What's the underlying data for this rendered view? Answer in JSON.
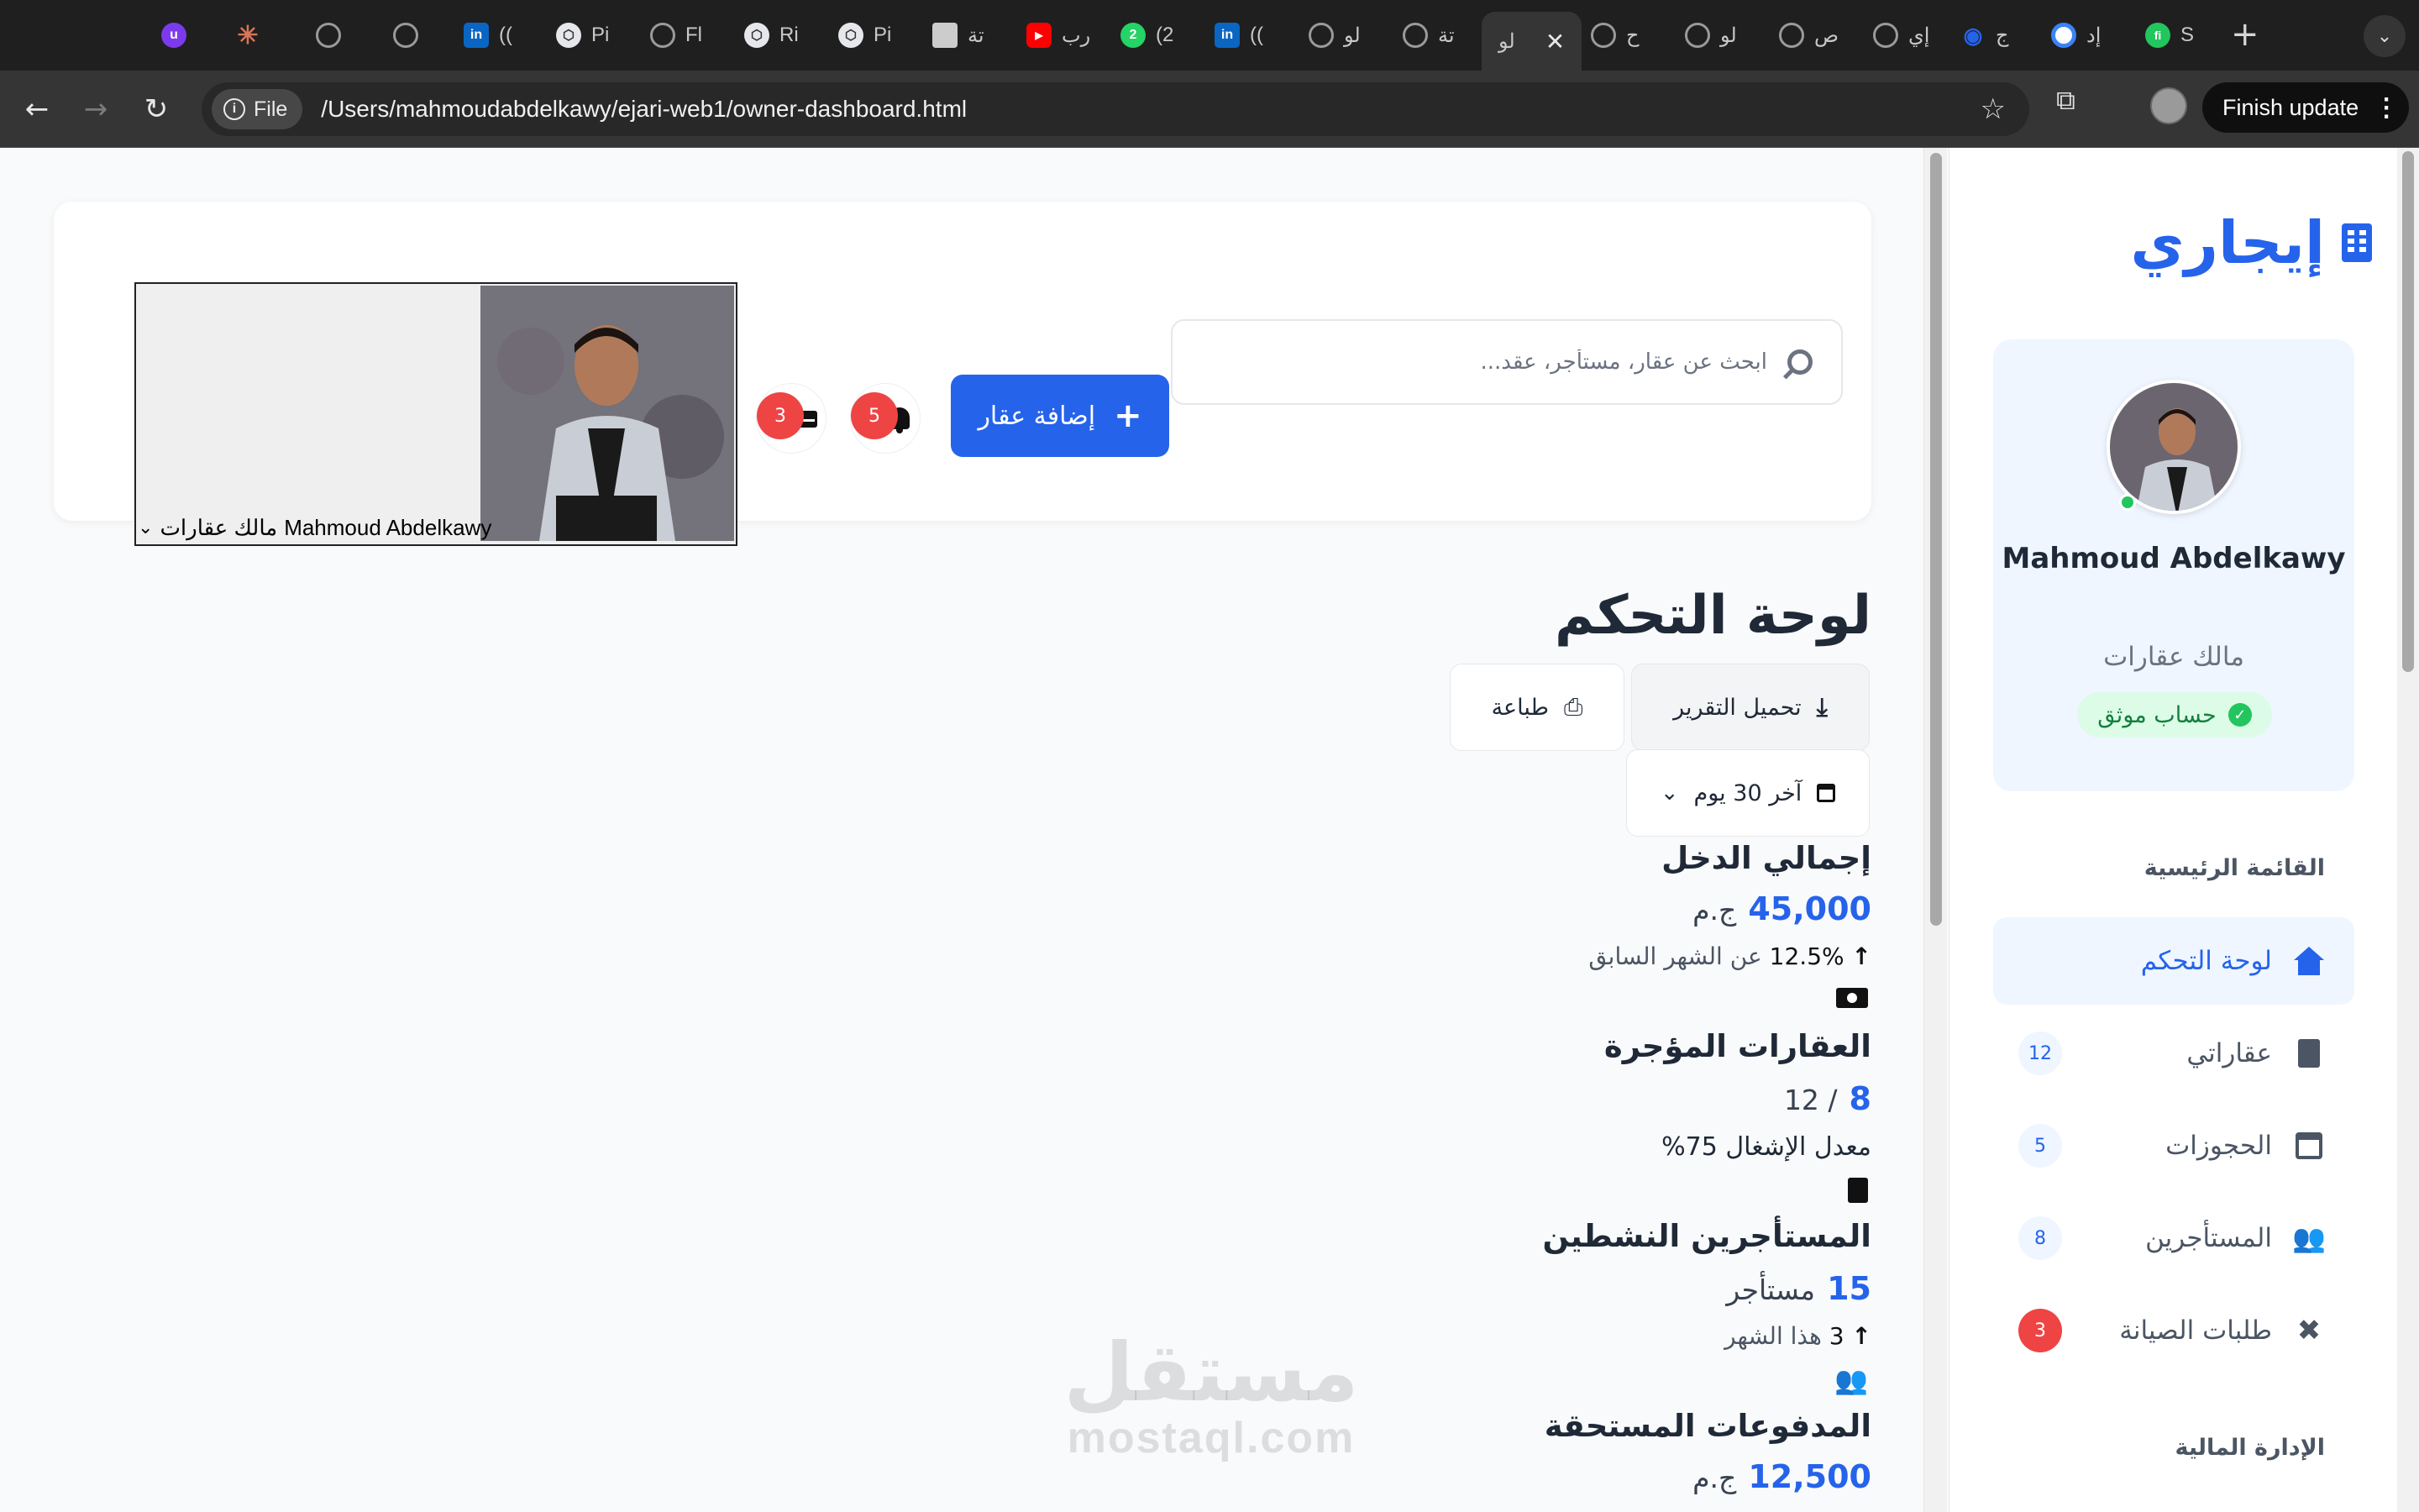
{
  "browser": {
    "tabs": [
      {
        "title": "",
        "favicon": "u-icon",
        "color": "#7c3aed"
      },
      {
        "title": "",
        "favicon": "sunburst-icon",
        "color": "#d97757"
      },
      {
        "title": "",
        "favicon": "globe-icon",
        "color": "#8a8a8a"
      },
      {
        "title": "",
        "favicon": "globe-icon",
        "color": "#8a8a8a"
      },
      {
        "title": "((",
        "favicon": "linkedin-icon",
        "color": "#0a66c2"
      },
      {
        "title": "Pi",
        "favicon": "hexagon-icon",
        "color": "#e5e7eb"
      },
      {
        "title": "Fl",
        "favicon": "globe-icon",
        "color": "#8a8a8a"
      },
      {
        "title": "Ri",
        "favicon": "hexagon-icon",
        "color": "#e5e7eb"
      },
      {
        "title": "Pi",
        "favicon": "hexagon-icon",
        "color": "#e5e7eb"
      },
      {
        "title": "تة",
        "favicon": "image-icon",
        "color": "#cccccc"
      },
      {
        "title": "رب",
        "favicon": "youtube-icon",
        "color": "#ff0000"
      },
      {
        "title": "(2",
        "favicon": "whatsapp-icon",
        "color": "#25d366"
      },
      {
        "title": "((",
        "favicon": "linkedin-icon",
        "color": "#0a66c2"
      },
      {
        "title": "لو",
        "favicon": "globe-icon",
        "color": "#8a8a8a"
      },
      {
        "title": "تة",
        "favicon": "globe-icon",
        "color": "#8a8a8a"
      },
      {
        "title": "لو",
        "favicon": "globe-icon",
        "color": "#8a8a8a",
        "active": true
      },
      {
        "title": "ح",
        "favicon": "globe-icon",
        "color": "#8a8a8a"
      },
      {
        "title": "لو",
        "favicon": "globe-icon",
        "color": "#8a8a8a"
      },
      {
        "title": "ص",
        "favicon": "globe-icon",
        "color": "#8a8a8a"
      },
      {
        "title": "إي",
        "favicon": "globe-icon",
        "color": "#8a8a8a"
      },
      {
        "title": "ج",
        "favicon": "eye-icon",
        "color": "#2563eb"
      },
      {
        "title": "إد",
        "favicon": "circle-icon",
        "color": "#3b82f6"
      },
      {
        "title": "S",
        "favicon": "fi-icon",
        "color": "#22c55e"
      }
    ],
    "chip_label": "File",
    "url": "/Users/mahmoudabdelkawy/ejari-web1/owner-dashboard.html",
    "finish_update": "Finish update"
  },
  "sidebar": {
    "logo": "إيجاري",
    "user_name": "Mahmoud Abdelkawy",
    "user_role": "مالك عقارات",
    "verified": "حساب موثق",
    "main_menu_title": "القائمة الرئيسية",
    "items": [
      {
        "label": "لوحة التحكم",
        "icon": "home-icon",
        "badge": ""
      },
      {
        "label": "عقاراتي",
        "icon": "building-icon",
        "badge": "12"
      },
      {
        "label": "الحجوزات",
        "icon": "calendar-icon",
        "badge": "5"
      },
      {
        "label": "المستأجرين",
        "icon": "users-icon",
        "badge": "8"
      },
      {
        "label": "طلبات الصيانة",
        "icon": "tools-icon",
        "badge": "3"
      }
    ],
    "finance_title": "الإدارة المالية"
  },
  "header": {
    "search_placeholder": "ابحث عن عقار، مستأجر، عقد...",
    "add_property": "إضافة عقار",
    "notifications_count": "5",
    "messages_count": "3",
    "profile_caption_name": "Mahmoud Abdelkawy",
    "profile_caption_role": "مالك عقارات"
  },
  "main": {
    "title": "لوحة التحكم",
    "download_report": "تحميل التقرير",
    "print": "طباعة",
    "period": "آخر 30 يوم",
    "stats": [
      {
        "title": "إجمالي الدخل",
        "value": "45,000",
        "unit": "ج.م",
        "change": "12.5%",
        "change_text": "عن الشهر السابق"
      },
      {
        "title": "العقارات المؤجرة",
        "value": "8",
        "unit": "/ 12",
        "sub": "معدل الإشغال 75%"
      },
      {
        "title": "المستأجرين النشطين",
        "value": "15",
        "unit": "مستأجر",
        "change": "3",
        "change_text": "هذا الشهر"
      },
      {
        "title": "المدفوعات المستحقة",
        "value": "12,500",
        "unit": "ج.م"
      }
    ]
  },
  "watermark": {
    "arabic": "مستقل",
    "latin": "mostaql.com"
  },
  "colors": {
    "primary": "#2563eb",
    "danger": "#ef4444",
    "success": "#22c55e"
  }
}
